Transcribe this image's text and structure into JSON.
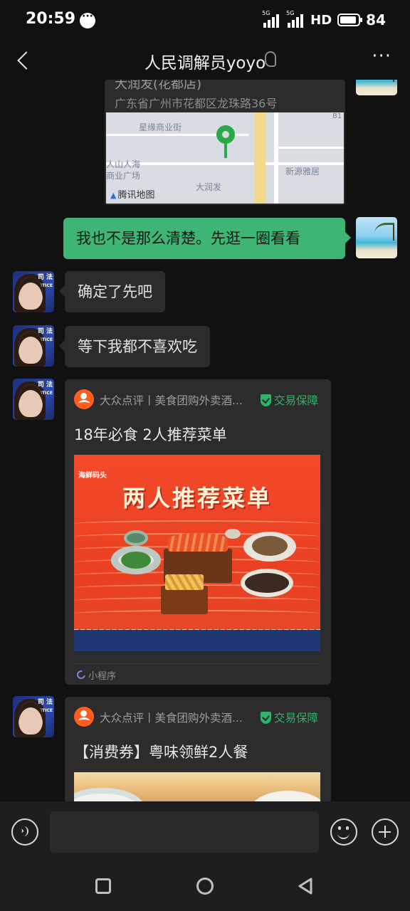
{
  "status_bar": {
    "time": "20:59",
    "network_1": "5G",
    "network_2": "5G",
    "hd": "HD",
    "battery": "84"
  },
  "header": {
    "title": "人民调解员yoyo"
  },
  "location": {
    "name": "大润发(花都店)",
    "address": "广东省广州市花都区龙珠路36号",
    "map_labels": [
      "星缘商业街",
      "人山人海",
      "商业广场",
      "新源雅居",
      "大润发",
      "B1"
    ],
    "map_brand": "腾讯地图"
  },
  "messages": [
    {
      "sender": "self",
      "text": "我也不是那么清楚。先逛一圈看看"
    },
    {
      "sender": "other",
      "text": "确定了先吧"
    },
    {
      "sender": "other",
      "text": "等下我都不喜欢吃"
    }
  ],
  "avatar": {
    "badge_line1": "司 法",
    "badge_line2": "JUSTICE"
  },
  "mini_programs": [
    {
      "source": "大众点评丨美食团购外卖酒...",
      "guarantee": "交易保障",
      "title": "18年必食 2人推荐菜单",
      "poster_brand": "海鲜码头",
      "poster_heading": "两人推荐菜单",
      "footer": "小程序"
    },
    {
      "source": "大众点评丨美食团购外卖酒...",
      "guarantee": "交易保障",
      "title": "【消费券】粤味领鲜2人餐"
    }
  ],
  "colors": {
    "background": "#111111",
    "self_bubble": "#3eb575",
    "other_bubble": "#2c2c2c",
    "guarantee_green": "#2fb36a",
    "dianping_orange": "#ff5c1f"
  },
  "icons": [
    "back-icon",
    "ear-icon",
    "more-icon",
    "voice-icon",
    "emoji-icon",
    "plus-icon",
    "shield-icon"
  ]
}
